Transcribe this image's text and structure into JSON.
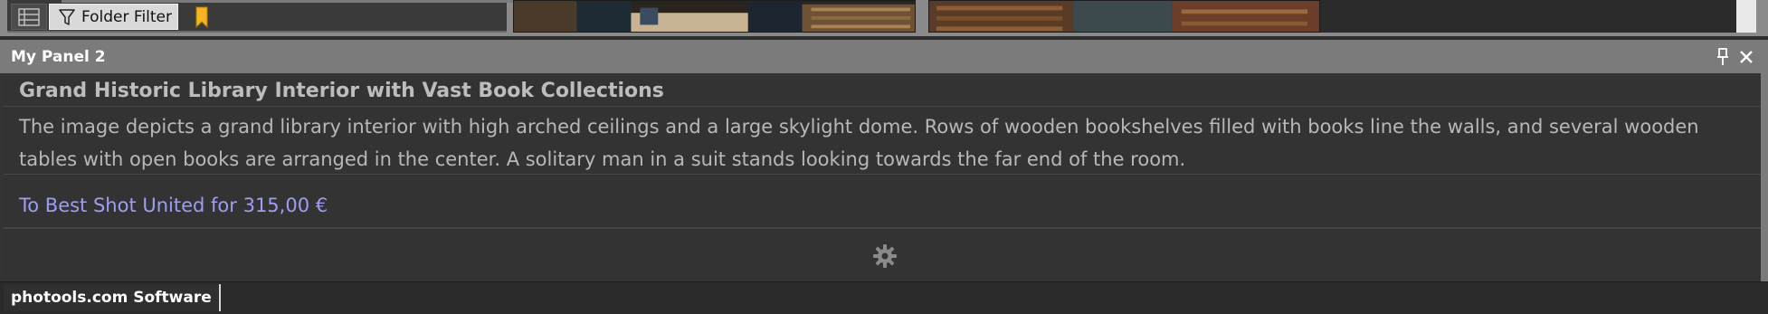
{
  "toolbar": {
    "view_icon": "list-view-icon",
    "filter_icon": "funnel-icon",
    "filter_label": "Folder Filter",
    "bookmark_icon": "bookmark-icon",
    "bookmark_color": "#f5b521"
  },
  "panel": {
    "title": "My Panel 2",
    "pin_icon": "pin-icon",
    "close_icon": "close-icon",
    "image_title": "Grand Historic Library Interior with Vast Book Collections",
    "description": "The image depicts a grand library interior with high arched ceilings and a large skylight dome. Rows of wooden bookshelves filled with books line the walls, and several wooden tables with open books are arranged in the center. A solitary man in a suit stands looking towards the far end of the room.",
    "buy_link": "To Best Shot United for 315,00 €",
    "link_color": "#9e9df5",
    "settings_icon": "gear-icon"
  },
  "footer": {
    "tab_label": "photools.com Software"
  }
}
